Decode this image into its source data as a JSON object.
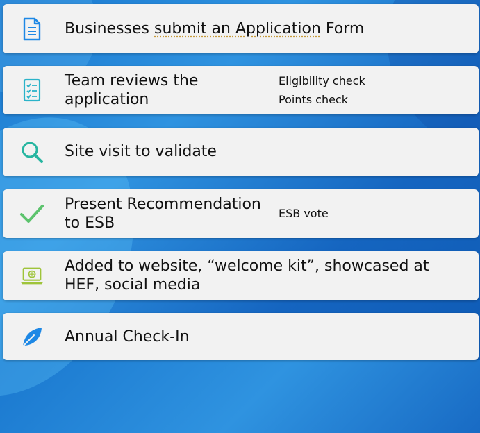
{
  "steps": [
    {
      "title": "Businesses submit an Application Form",
      "icon": "document-icon",
      "color": "#1e88e5"
    },
    {
      "title_lines": [
        "Team reviews the",
        "application"
      ],
      "notes": [
        "Eligibility check",
        "Points check"
      ],
      "icon": "checklist-icon",
      "color": "#2bb3c9"
    },
    {
      "title": "Site visit to validate",
      "icon": "search-icon",
      "color": "#26b5a0"
    },
    {
      "title_lines": [
        "Present Recommendation",
        "to ESB"
      ],
      "notes": [
        "ESB vote"
      ],
      "icon": "checkmark-icon",
      "color": "#5cc36d"
    },
    {
      "title_lines": [
        "Added to website, “welcome kit”, showcased at",
        "HEF, social media"
      ],
      "icon": "laptop-icon",
      "color": "#9fc43a"
    },
    {
      "title": "Annual Check-In",
      "icon": "leaf-icon",
      "color": "#1e88e5"
    }
  ]
}
